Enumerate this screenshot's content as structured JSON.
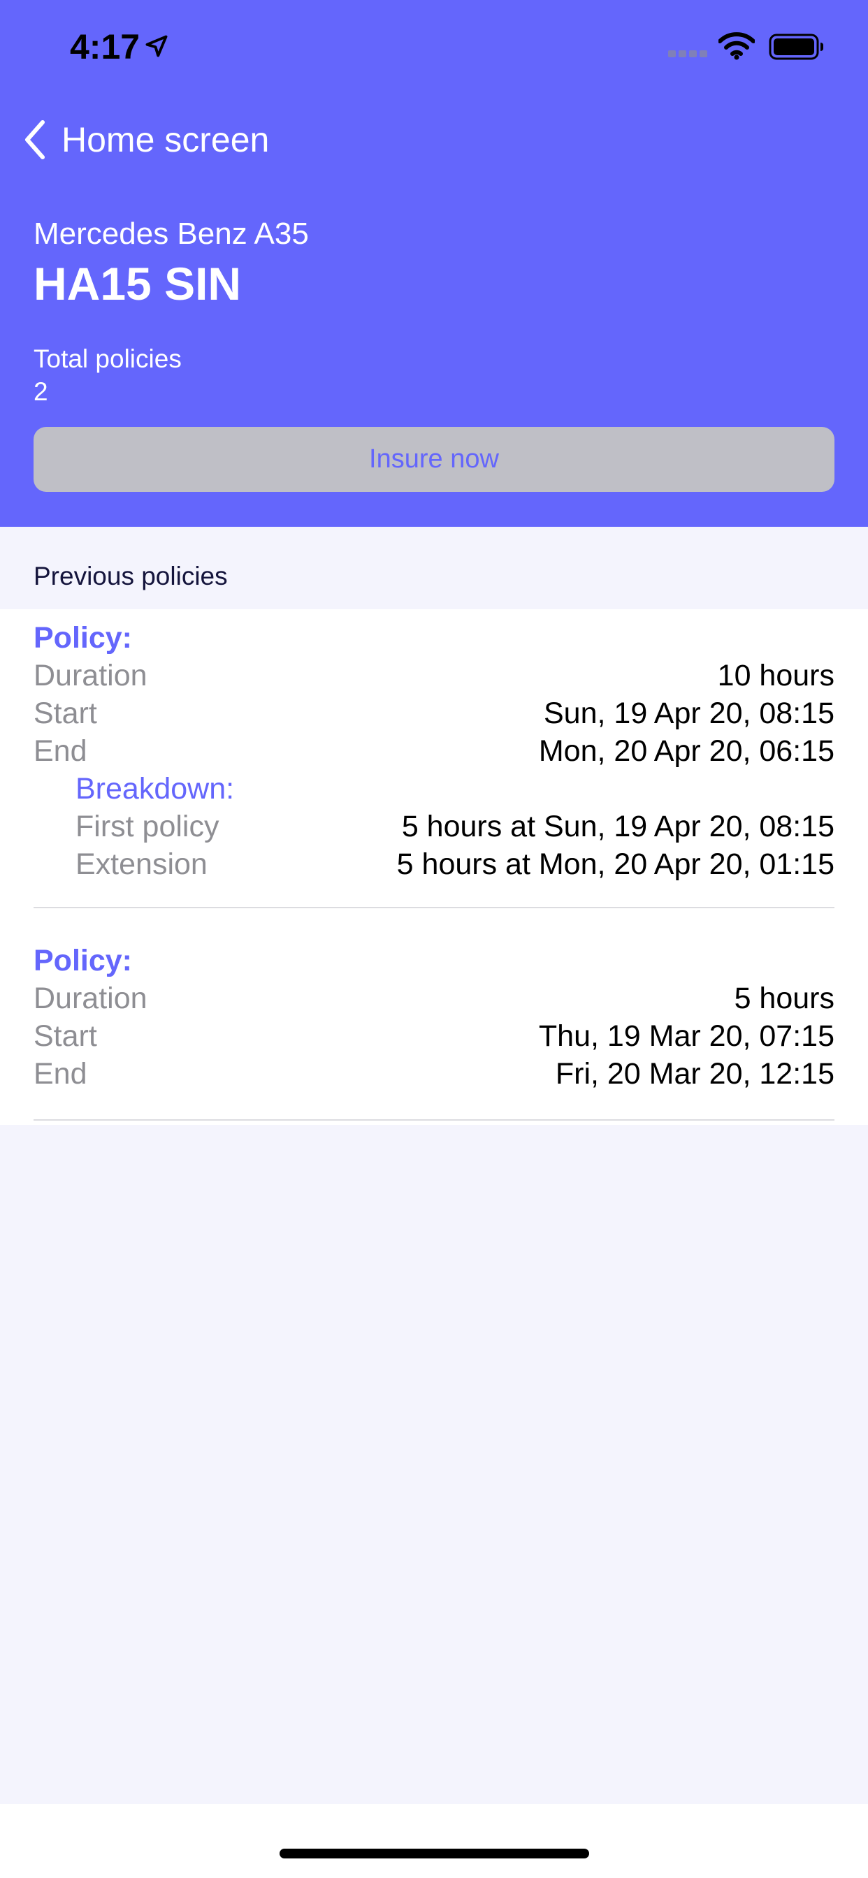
{
  "status_bar": {
    "time": "4:17"
  },
  "nav": {
    "back_label": "Home screen"
  },
  "vehicle": {
    "model": "Mercedes Benz A35",
    "plate": "HA15 SIN"
  },
  "summary": {
    "total_label": "Total policies",
    "total_value": "2"
  },
  "actions": {
    "insure_label": "Insure now"
  },
  "section": {
    "title": "Previous policies"
  },
  "policies": [
    {
      "title": "Policy:",
      "rows": [
        {
          "label": "Duration",
          "value": "10 hours"
        },
        {
          "label": "Start",
          "value": "Sun, 19 Apr 20, 08:15"
        },
        {
          "label": "End",
          "value": "Mon, 20 Apr 20, 06:15"
        }
      ],
      "breakdown": {
        "title": "Breakdown:",
        "rows": [
          {
            "label": "First policy",
            "value": "5 hours at Sun, 19 Apr 20, 08:15"
          },
          {
            "label": "Extension",
            "value": "5 hours at Mon, 20 Apr 20, 01:15"
          }
        ]
      }
    },
    {
      "title": "Policy:",
      "rows": [
        {
          "label": "Duration",
          "value": "5 hours"
        },
        {
          "label": "Start",
          "value": "Thu, 19 Mar 20, 07:15"
        },
        {
          "label": "End",
          "value": "Fri, 20 Mar 20, 12:15"
        }
      ]
    }
  ],
  "colors": {
    "brand": "#6466fc",
    "button_bg": "#bfbfc6",
    "background": "#f4f4fd",
    "secondary_text": "#8e8e93"
  },
  "icons": [
    "location-arrow-icon",
    "signal-icon",
    "wifi-icon",
    "battery-icon",
    "chevron-left-icon"
  ]
}
